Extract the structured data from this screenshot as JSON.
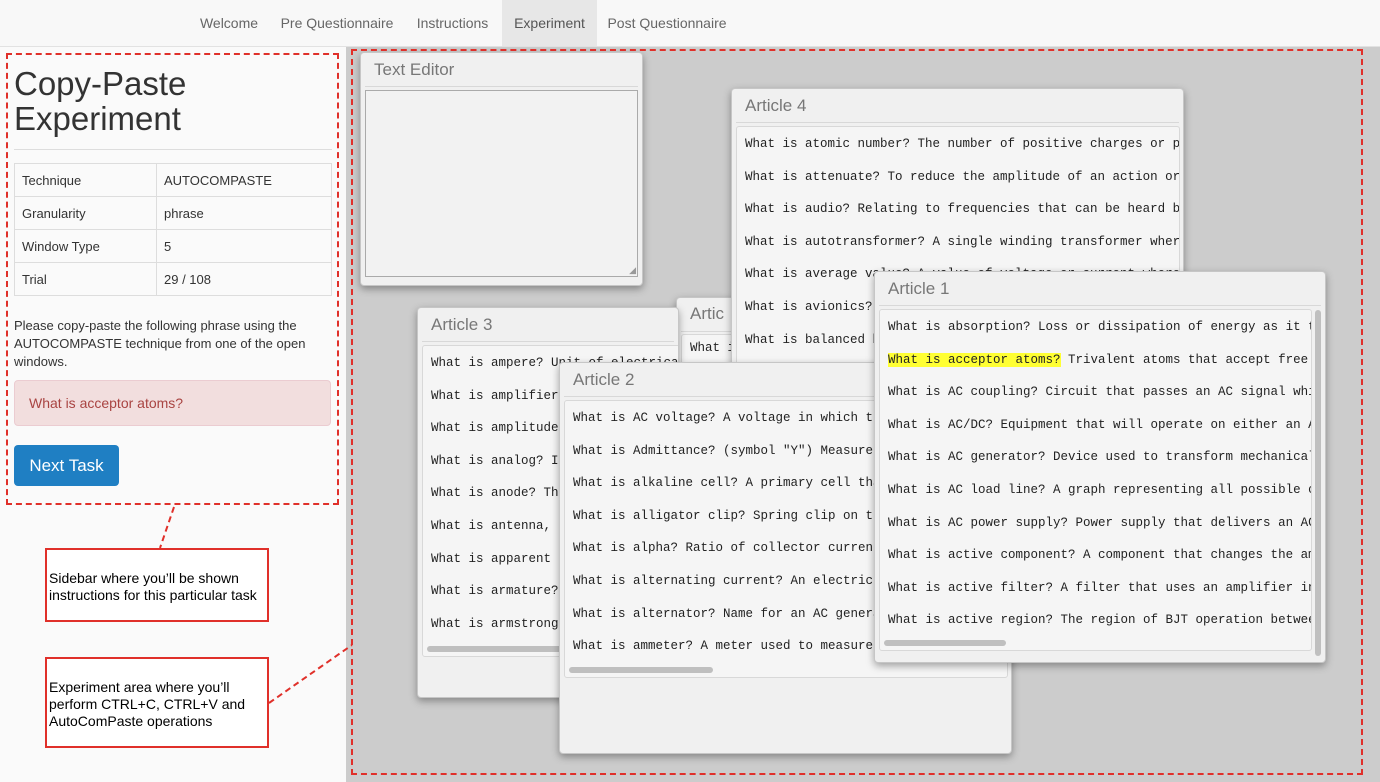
{
  "nav": {
    "tabs": [
      "Welcome",
      "Pre Questionnaire",
      "Instructions",
      "Experiment",
      "Post Questionnaire"
    ],
    "active": "Experiment"
  },
  "sidebar": {
    "title_line1": "Copy-Paste",
    "title_line2": "Experiment",
    "table": [
      {
        "key": "Technique",
        "value": "AUTOCOMPASTE"
      },
      {
        "key": "Granularity",
        "value": "phrase"
      },
      {
        "key": "Window Type",
        "value": "5"
      },
      {
        "key": "Trial",
        "value": "29 / 108"
      }
    ],
    "instruction": "Please copy-paste the following phrase using the AUTOCOMPASTE technique from one of the open windows.",
    "target_phrase": "What is acceptor atoms?",
    "next_button": "Next Task"
  },
  "annotations": {
    "sidebar_note": "Sidebar where you’ll be shown instructions for this particular task",
    "experiment_note": "Experiment area where you’ll perform CTRL+C, CTRL+V and AutoComPaste operations"
  },
  "windows": {
    "text_editor": {
      "title": "Text Editor",
      "value": ""
    },
    "article5": {
      "title": "Artic",
      "lines": [
        "What i"
      ]
    },
    "article4": {
      "title": "Article 4",
      "lines": [
        "What is atomic number? The number of positive charges or prot",
        "What is attenuate? To reduce the amplitude of an action or si",
        "What is audio? Relating to frequencies that can be heard by t",
        "What is autotransformer? A single winding transformer where t",
        "What is average value? A value of voltage or current where th",
        "What is avionics? ",
        "What is balanced b"
      ]
    },
    "article3": {
      "title": "Article 3",
      "lines": [
        "What is ampere? Unit of electrical",
        "What is amplifier? ",
        "What is amplitude? ",
        "What is analog? In",
        "What is anode? The",
        "What is antenna, r",
        "What is apparent p",
        "What is armature? ",
        "What is armstrong "
      ]
    },
    "article2": {
      "title": "Article 2",
      "lines": [
        "What is AC voltage? A voltage in which the",
        "What is Admittance? (symbol \"Y\") Measure of",
        "What is alkaline cell? A primary cell that",
        "What is alligator clip? Spring clip on the",
        "What is alpha? Ratio of collector current t",
        "What is alternating current? An electric cu",
        "What is alternator? Name for an AC generato",
        "What is ammeter? A meter used to measure cu"
      ]
    },
    "article1": {
      "title": "Article 1",
      "highlight": "What is acceptor atoms?",
      "highlight_rest": " Trivalent atoms that accept free el",
      "lines": [
        "What is absorption? Loss or dissipation of energy as it tra",
        "",
        "What is AC coupling? Circuit that passes an AC signal while",
        "What is AC/DC? Equipment that will operate on either an AC ",
        "What is AC generator? Device used to transform mechanical e",
        "What is AC load line? A graph representing all possible com",
        "What is AC power supply? Power supply that delivers an AC v",
        "What is active component? A component that changes the ampl",
        "What is active filter? A filter that uses an amplifier in a",
        "What is active region? The region of BJT operation between "
      ]
    }
  },
  "colors": {
    "accent": "#1f7fc3",
    "annotation": "#e0302a",
    "alert_bg": "#f2dede",
    "alert_text": "#a94442",
    "highlight": "#ffff33"
  }
}
